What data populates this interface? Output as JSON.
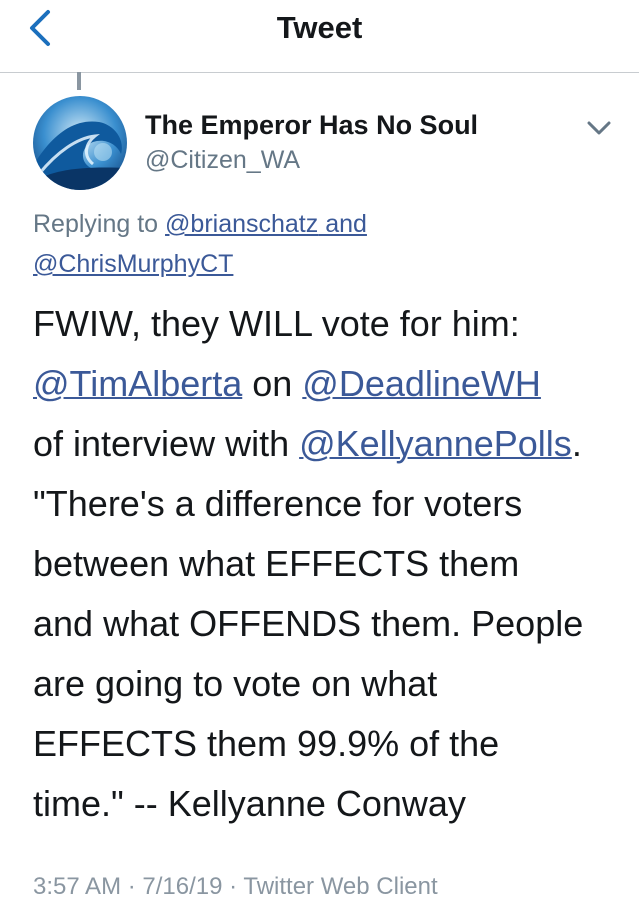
{
  "header": {
    "title": "Tweet",
    "back_icon": "chevron-left-icon"
  },
  "tweet": {
    "author_name": "The Emperor Has No Soul",
    "author_handle": "@Citizen_WA",
    "avatar_icon": "wave-avatar",
    "reply": {
      "prefix": "Replying to ",
      "mention1": "@brianschatz",
      "joiner": " and",
      "mention2": "@ChrisMurphyCT"
    },
    "body_lines": {
      "l1": "FWIW, they WILL vote for him:",
      "l2_m1": "@TimAlberta",
      "l2_mid": " on ",
      "l2_m2": "@DeadlineWH",
      "l3_pre": "of interview with ",
      "l3_m": "@KellyannePolls",
      "l3_post": ".",
      "l4": "\"There's a difference for voters",
      "l5": "between what EFFECTS them",
      "l6": "and what OFFENDS them. People",
      "l7": "are going to vote on what",
      "l8": "EFFECTS them 99.9% of the",
      "l9": "time.\" --  Kellyanne Conway"
    },
    "footer_partial": "3:57 AM · 7/16/19 · Twitter Web Client"
  },
  "colors": {
    "link": "#3b5998",
    "secondary": "#657786",
    "accent": "#1b6fbd"
  }
}
